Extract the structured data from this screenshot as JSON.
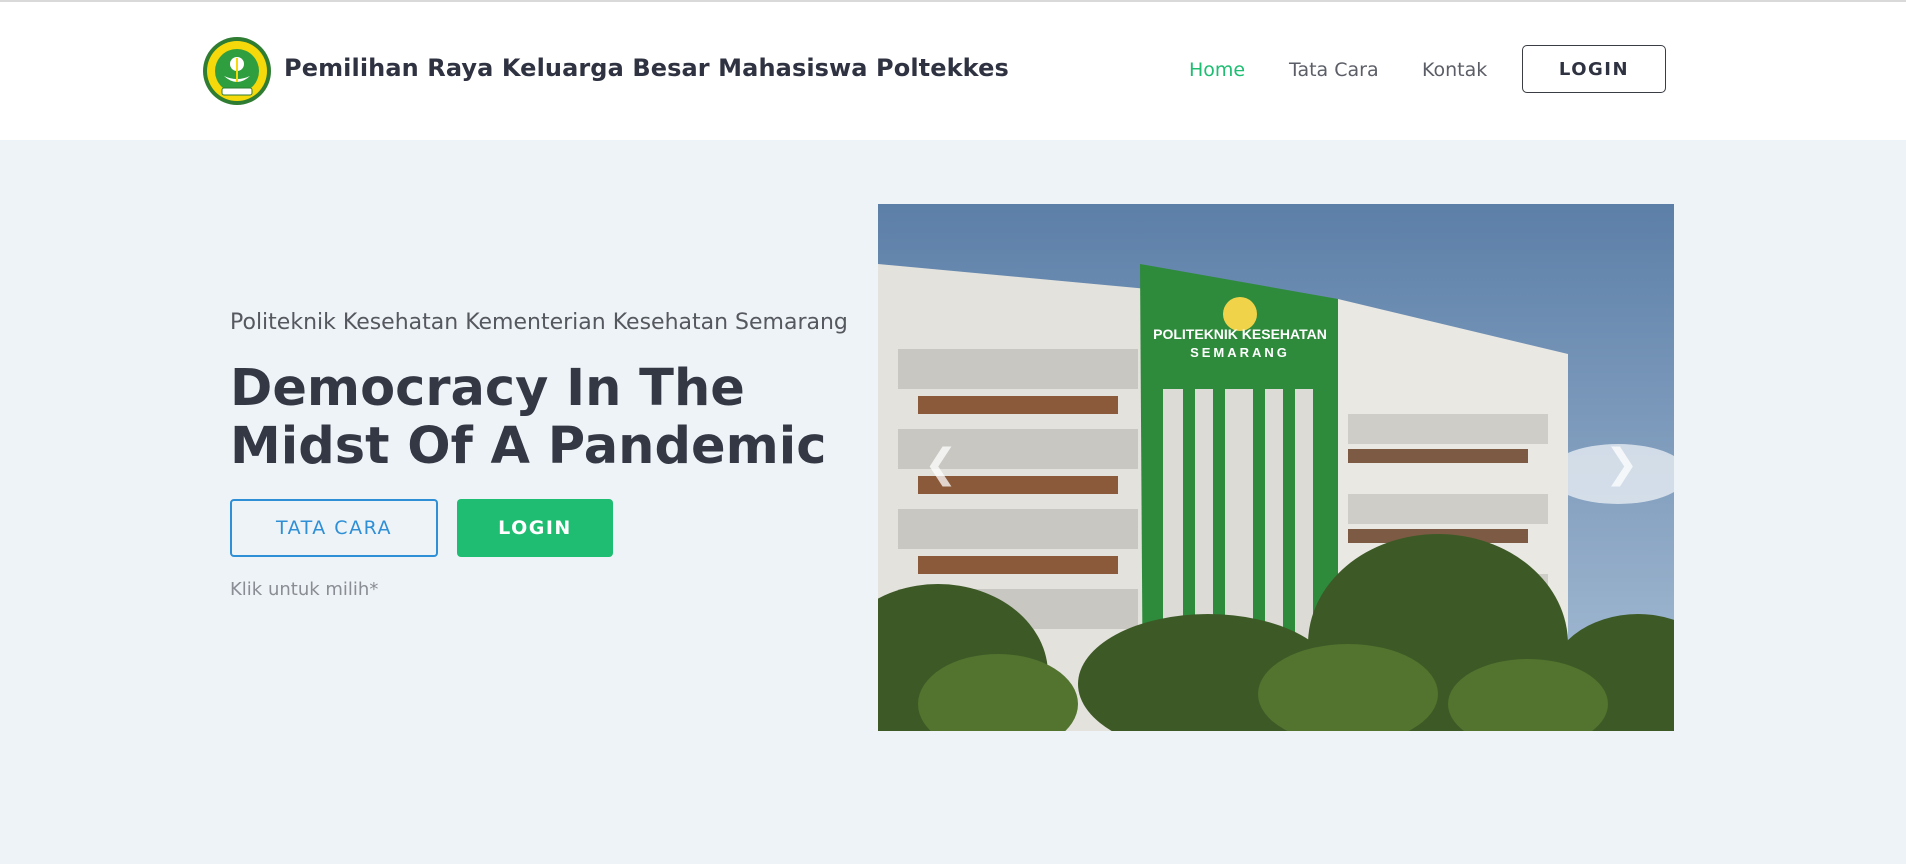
{
  "header": {
    "brand_title": "Pemilihan Raya Keluarga Besar Mahasiswa Poltekkes",
    "logo_text_top": "POLITEKNIK KESEHATAN",
    "logo_text_bottom": "SEMARANG",
    "nav": [
      {
        "label": "Home",
        "active": true
      },
      {
        "label": "Tata Cara",
        "active": false
      },
      {
        "label": "Kontak",
        "active": false
      }
    ],
    "login_label": "LOGIN"
  },
  "hero": {
    "subtitle": "Politeknik Kesehatan Kementerian Kesehatan Semarang",
    "title": "Democracy In The Midst Of A Pandemic",
    "btn_tata_cara": "TATA CARA",
    "btn_login": "LOGIN",
    "hint": "Klik untuk milih*"
  },
  "carousel": {
    "building_sign_line1": "POLITEKNIK KESEHATAN",
    "building_sign_line2": "SEMARANG",
    "prev_icon": "chevron-left-icon",
    "next_icon": "chevron-right-icon"
  },
  "colors": {
    "accent_green": "#1ebd72",
    "accent_blue": "#2f8fd6",
    "background": "#eef3f7",
    "text_dark": "#343744"
  }
}
